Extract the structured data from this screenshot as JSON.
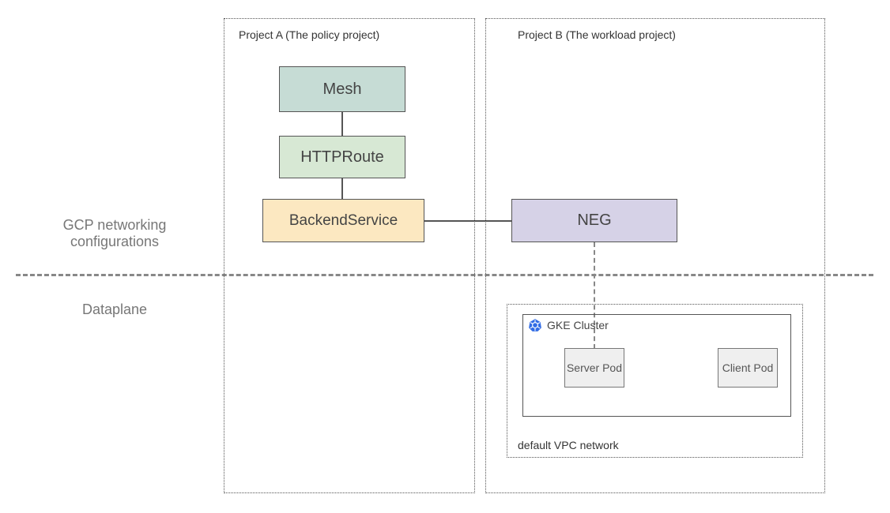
{
  "labels": {
    "gcp": "GCP networking configurations",
    "dataplane": "Dataplane"
  },
  "projectA": {
    "title": "Project A (The policy project)",
    "mesh": "Mesh",
    "httproute": "HTTPRoute",
    "backendservice": "BackendService"
  },
  "projectB": {
    "title": "Project B (The workload project)",
    "neg": "NEG",
    "gke": "GKE Cluster",
    "serverPod": "Server Pod",
    "clientPod": "Client Pod",
    "vpc": "default VPC network"
  },
  "colors": {
    "mesh": "#c6dcd5",
    "httproute": "#d7e8d4",
    "backendservice": "#fce8c1",
    "neg": "#d6d2e7"
  }
}
